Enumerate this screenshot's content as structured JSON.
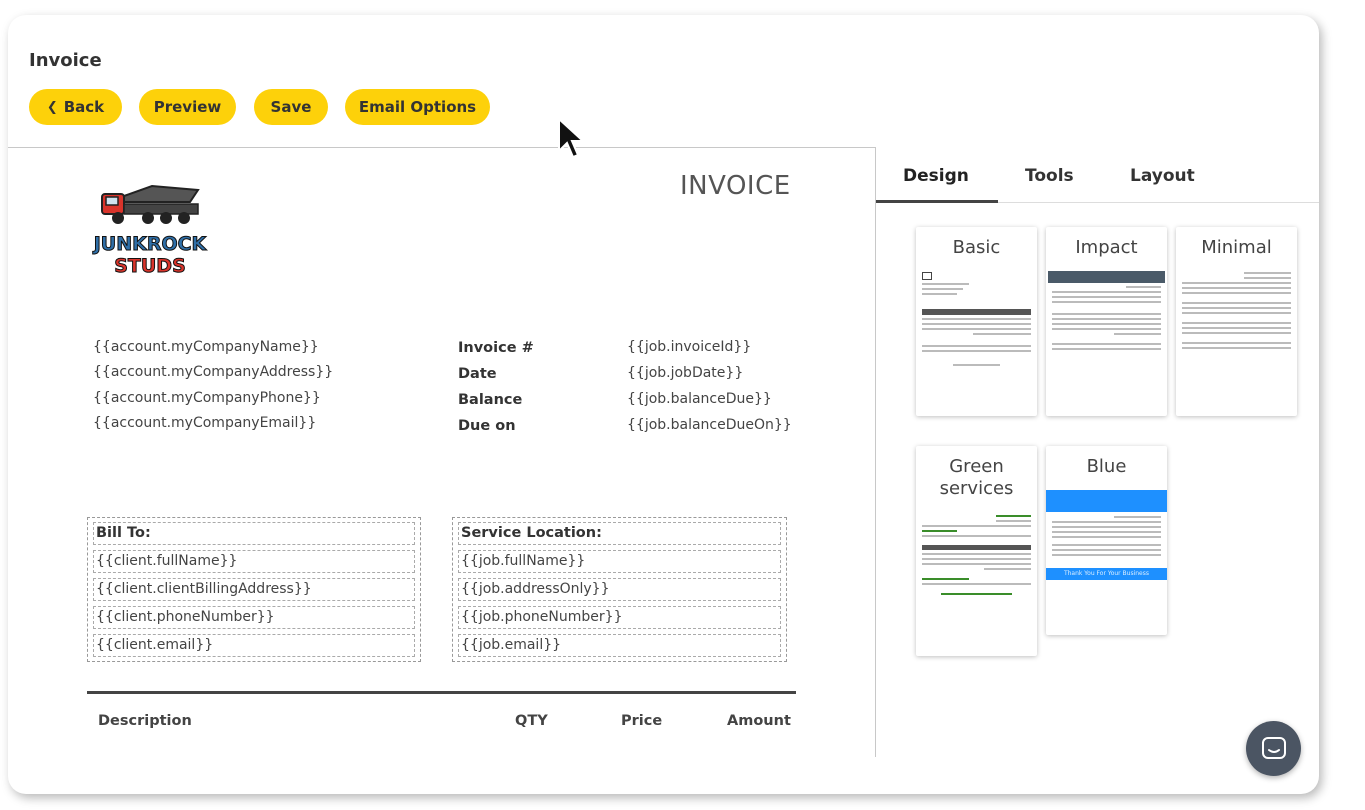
{
  "header": {
    "title": "Invoice",
    "buttons": {
      "back": "Back",
      "preview": "Preview",
      "save": "Save",
      "email": "Email Options"
    }
  },
  "invoice": {
    "heading": "INVOICE",
    "logo_text": [
      "JUNKROCK",
      "STUDS"
    ],
    "company_lines": [
      "{{account.myCompanyName}}",
      "{{account.myCompanyAddress}}",
      "{{account.myCompanyPhone}}",
      "{{account.myCompanyEmail}}"
    ],
    "meta_labels": [
      "Invoice #",
      "Date",
      "Balance",
      "Due on"
    ],
    "meta_values": [
      "{{job.invoiceId}}",
      "{{job.jobDate}}",
      "{{job.balanceDue}}",
      "{{job.balanceDueOn}}"
    ],
    "bill_to": {
      "heading": "Bill To:",
      "lines": [
        "{{client.fullName}}",
        "{{client.clientBillingAddress}}",
        "{{client.phoneNumber}}",
        "{{client.email}}"
      ]
    },
    "service_location": {
      "heading": "Service Location:",
      "lines": [
        "{{job.fullName}}",
        "{{job.addressOnly}}",
        "{{job.phoneNumber}}",
        "{{job.email}}"
      ]
    },
    "table_headers": [
      "Description",
      "QTY",
      "Price",
      "Amount"
    ]
  },
  "panel": {
    "tabs": [
      "Design",
      "Tools",
      "Layout"
    ],
    "active_tab": "Design",
    "templates": [
      {
        "name": "Basic",
        "accent": "#555555"
      },
      {
        "name": "Impact",
        "accent": "#4a5a68"
      },
      {
        "name": "Minimal",
        "accent": "#ffffff"
      },
      {
        "name": "Green services",
        "accent": "#3a8d2a"
      },
      {
        "name": "Blue",
        "accent": "#1e90ff",
        "footer": "Thank You For Your Business"
      }
    ]
  },
  "colors": {
    "button": "#fdd10a",
    "chat": "#4b5563"
  }
}
